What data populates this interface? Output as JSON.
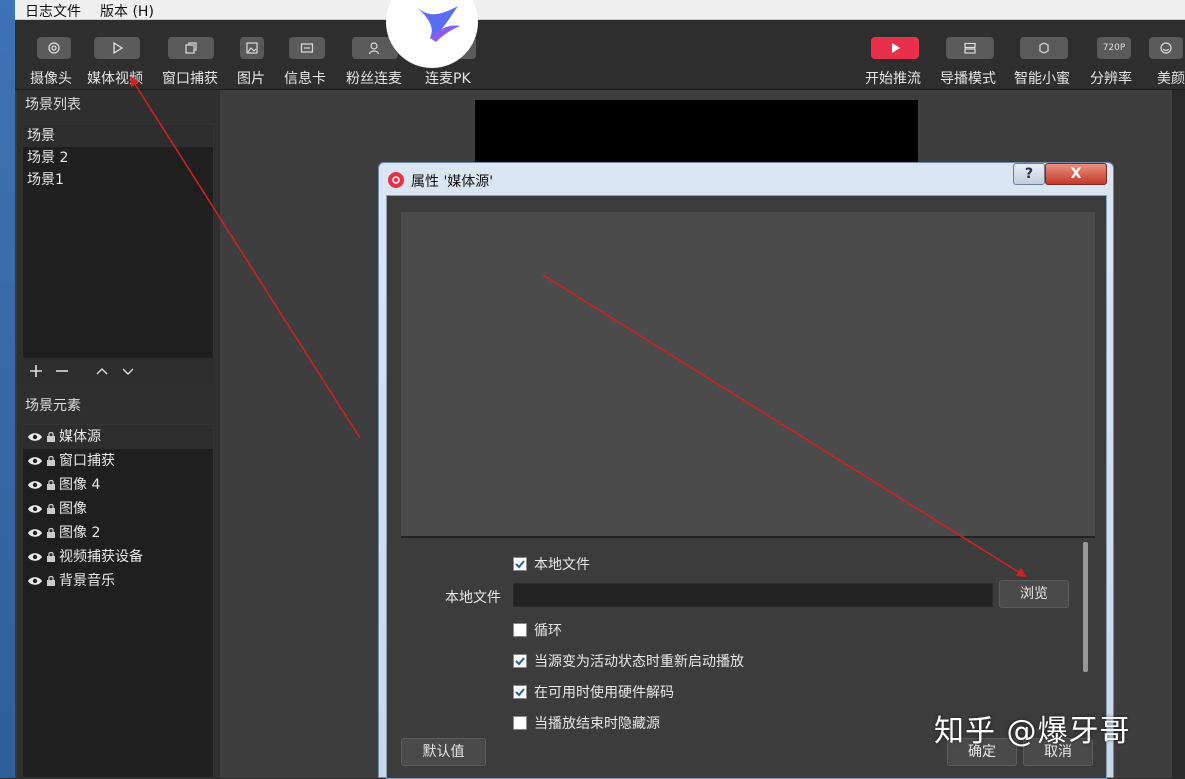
{
  "menubar": {
    "items": [
      "日志文件",
      "版本 (H)"
    ]
  },
  "toolbar": {
    "left": [
      {
        "label": "摄像头",
        "icon": "camera-icon"
      },
      {
        "label": "媒体视频",
        "icon": "play-icon"
      },
      {
        "label": "窗口捕获",
        "icon": "window-icon"
      },
      {
        "label": "图片",
        "icon": "image-icon"
      },
      {
        "label": "信息卡",
        "icon": "card-icon"
      },
      {
        "label": "粉丝连麦",
        "icon": "user-icon"
      },
      {
        "label": "连麦PK",
        "icon": "pk-icon"
      }
    ],
    "right": [
      {
        "label": "开始推流",
        "icon": "play-icon",
        "accent": "#e8304a"
      },
      {
        "label": "导播模式",
        "icon": "layers-icon"
      },
      {
        "label": "智能小蜜",
        "icon": "bot-icon"
      },
      {
        "label": "分辨率",
        "badge": "720P"
      },
      {
        "label": "美颜",
        "icon": "smile-icon"
      }
    ]
  },
  "scenes": {
    "title": "场景列表",
    "items": [
      "场景",
      "场景 2",
      "场景1"
    ],
    "controls": [
      "+",
      "−",
      "^",
      "v"
    ]
  },
  "sources": {
    "title": "场景元素",
    "items": [
      "媒体源",
      "窗口捕获",
      "图像 4",
      "图像",
      "图像 2",
      "视频捕获设备",
      "背景音乐"
    ]
  },
  "dialog": {
    "title": "属性 '媒体源'",
    "help": "?",
    "close": "X",
    "local_file_checkbox": "本地文件",
    "local_file_label": "本地文件",
    "local_file_value": "",
    "browse": "浏览",
    "loop": "循环",
    "restart": "当源变为活动状态时重新启动播放",
    "hw_decode": "在可用时使用硬件解码",
    "hide_end": "当播放结束时隐藏源",
    "defaults": "默认值",
    "ok": "确定",
    "cancel": "取消",
    "checked": {
      "local_file": true,
      "loop": false,
      "restart": true,
      "hw_decode": true,
      "hide_end": false
    }
  },
  "watermark": "知乎 @爆牙哥",
  "colors": {
    "accent": "#e8304a",
    "arrow": "#d42020"
  }
}
